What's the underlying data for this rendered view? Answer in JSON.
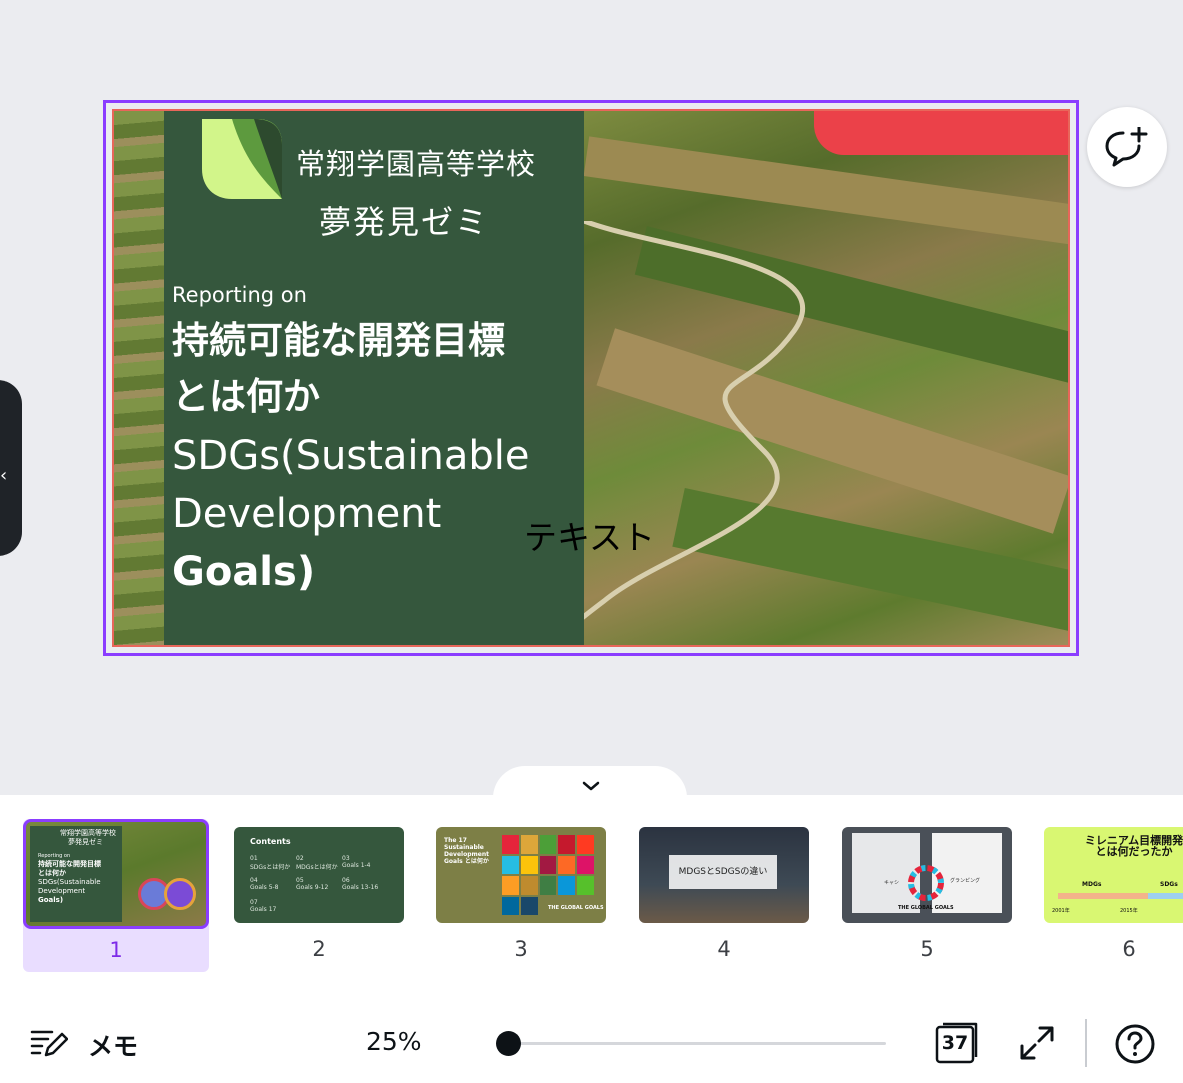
{
  "slide": {
    "school_name": "常翔学園高等学校",
    "seminar_name": "夢発見ゼミ",
    "reporting": "Reporting on",
    "title_line1": "持続可能な開発目標",
    "title_line2": "とは何か",
    "sdgs_line1": "SDGs(Sustainable",
    "sdgs_line2": "Development",
    "sdgs_line3": "Goals)",
    "text_placeholder": "テキスト"
  },
  "thumbnails": [
    {
      "number": "1",
      "selected": true,
      "lines": [
        "常翔学園高等学校",
        "夢発見ゼミ",
        "Reporting on",
        "持続可能な開発目標",
        "とは何か",
        "SDGs(Sustainable",
        "Development",
        "Goals)"
      ]
    },
    {
      "number": "2",
      "title": "Contents",
      "items": [
        "01",
        "SDGsとは何か",
        "02",
        "MDGsとは何か",
        "03",
        "Goals 1-4",
        "04",
        "Goals 5-8",
        "05",
        "Goals 9-12",
        "06",
        "Goals 13-16",
        "07",
        "Goals 17"
      ]
    },
    {
      "number": "3",
      "title": "The 17 Sustainable Development Goals とは何か",
      "caption": "THE GLOBAL GOALS"
    },
    {
      "number": "4",
      "box_text": "MDGSとSDGSの違い"
    },
    {
      "number": "5",
      "left_label": "キャシ",
      "right_label": "グランピング",
      "caption": "THE GLOBAL GOALS"
    },
    {
      "number": "6",
      "heading": "ミレニアム目標開発とは何だったか",
      "label_left": "MDGs",
      "label_right": "SDGs",
      "year_left": "2001年",
      "year_right": "2015年"
    }
  ],
  "toolbar": {
    "notes_label": "メモ",
    "zoom": "25%",
    "zoom_value": 0.03,
    "page_count": "37"
  },
  "colors": {
    "accent": "#8b3dff",
    "panel_green": "#35573d",
    "red_mark": "#eb4149"
  },
  "icons": {
    "comment": "comment-plus-icon",
    "collapse": "chevron-down-icon",
    "side": "chevron-left-icon",
    "notes": "notes-pencil-icon",
    "pages": "pages-stack-icon",
    "fullscreen": "expand-arrows-icon",
    "help": "question-circle-icon"
  }
}
